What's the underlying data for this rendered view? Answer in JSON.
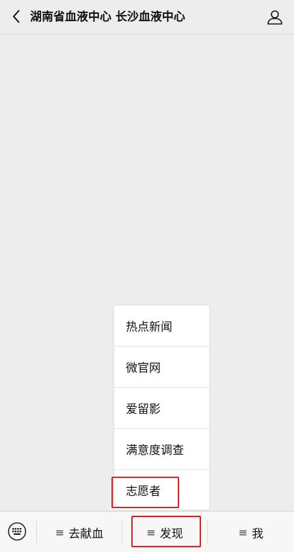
{
  "header": {
    "title": "湖南省血液中心 长沙血液中心"
  },
  "icons": {
    "back": "chevron-left-icon",
    "user": "user-icon",
    "keyboard": "keyboard-icon",
    "menu": "menu-lines-icon"
  },
  "popup": {
    "items": [
      {
        "label": "热点新闻"
      },
      {
        "label": "微官网"
      },
      {
        "label": "爱留影"
      },
      {
        "label": "满意度调查"
      },
      {
        "label": "志愿者"
      }
    ],
    "highlight_color": "#e02020"
  },
  "bottom_menu": {
    "tabs": [
      {
        "glyph": "≡",
        "label": "去献血"
      },
      {
        "glyph": "≡",
        "label": "发现"
      },
      {
        "glyph": "≡",
        "label": "我"
      }
    ]
  }
}
